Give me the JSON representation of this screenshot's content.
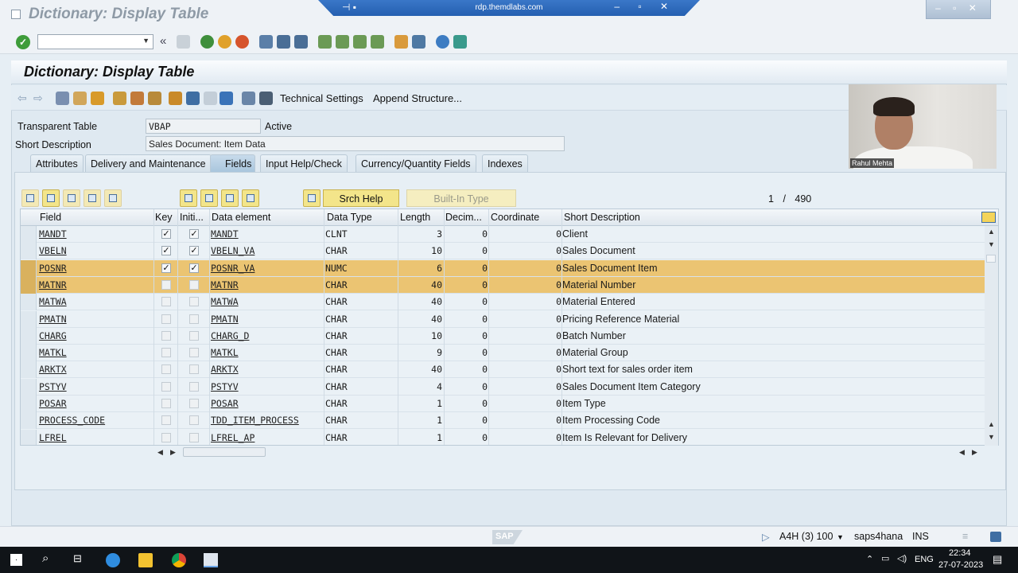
{
  "window": {
    "title": "Dictionary: Display Table",
    "rdp_host": "rdp.themdlabs.com"
  },
  "screen": {
    "title": "Dictionary: Display Table",
    "toolbar_links": [
      "Technical Settings",
      "Append Structure..."
    ]
  },
  "form": {
    "transparent_table_label": "Transparent Table",
    "transparent_table_value": "VBAP",
    "status": "Active",
    "short_description_label": "Short Description",
    "short_description_value": "Sales Document: Item Data"
  },
  "tabs": [
    {
      "label": "Attributes",
      "active": false
    },
    {
      "label": "Delivery and Maintenance",
      "active": false
    },
    {
      "label": "Fields",
      "active": true
    },
    {
      "label": "Input Help/Check",
      "active": false
    },
    {
      "label": "Currency/Quantity Fields",
      "active": false
    },
    {
      "label": "Indexes",
      "active": false
    }
  ],
  "table_toolbar": {
    "srch_help": "Srch Help",
    "built_in_type": "Built-In Type",
    "pager_current": "1",
    "pager_sep": "/",
    "pager_total": "490"
  },
  "columns": [
    "Field",
    "Key",
    "Initi...",
    "Data element",
    "Data Type",
    "Length",
    "Decim...",
    "Coordinate",
    "Short Description"
  ],
  "rows": [
    {
      "field": "MANDT",
      "key": true,
      "init": true,
      "element": "MANDT",
      "type": "CLNT",
      "length": "3",
      "dec": "0",
      "coord": "0",
      "desc": "Client",
      "selected": false
    },
    {
      "field": "VBELN",
      "key": true,
      "init": true,
      "element": "VBELN_VA",
      "type": "CHAR",
      "length": "10",
      "dec": "0",
      "coord": "0",
      "desc": "Sales Document",
      "selected": false
    },
    {
      "field": "POSNR",
      "key": true,
      "init": true,
      "element": "POSNR_VA",
      "type": "NUMC",
      "length": "6",
      "dec": "0",
      "coord": "0",
      "desc": "Sales Document Item",
      "selected": true
    },
    {
      "field": "MATNR",
      "key": false,
      "init": false,
      "element": "MATNR",
      "type": "CHAR",
      "length": "40",
      "dec": "0",
      "coord": "0",
      "desc": "Material Number",
      "selected": true
    },
    {
      "field": "MATWA",
      "key": false,
      "init": false,
      "element": "MATWA",
      "type": "CHAR",
      "length": "40",
      "dec": "0",
      "coord": "0",
      "desc": "Material Entered",
      "selected": false
    },
    {
      "field": "PMATN",
      "key": false,
      "init": false,
      "element": "PMATN",
      "type": "CHAR",
      "length": "40",
      "dec": "0",
      "coord": "0",
      "desc": "Pricing Reference Material",
      "selected": false
    },
    {
      "field": "CHARG",
      "key": false,
      "init": false,
      "element": "CHARG_D",
      "type": "CHAR",
      "length": "10",
      "dec": "0",
      "coord": "0",
      "desc": "Batch Number",
      "selected": false
    },
    {
      "field": "MATKL",
      "key": false,
      "init": false,
      "element": "MATKL",
      "type": "CHAR",
      "length": "9",
      "dec": "0",
      "coord": "0",
      "desc": "Material Group",
      "selected": false
    },
    {
      "field": "ARKTX",
      "key": false,
      "init": false,
      "element": "ARKTX",
      "type": "CHAR",
      "length": "40",
      "dec": "0",
      "coord": "0",
      "desc": "Short text for sales order item",
      "selected": false
    },
    {
      "field": "PSTYV",
      "key": false,
      "init": false,
      "element": "PSTYV",
      "type": "CHAR",
      "length": "4",
      "dec": "0",
      "coord": "0",
      "desc": "Sales Document Item Category",
      "selected": false
    },
    {
      "field": "POSAR",
      "key": false,
      "init": false,
      "element": "POSAR",
      "type": "CHAR",
      "length": "1",
      "dec": "0",
      "coord": "0",
      "desc": "Item Type",
      "selected": false
    },
    {
      "field": "PROCESS_CODE",
      "key": false,
      "init": false,
      "element": "TDD_ITEM_PROCESS",
      "type": "CHAR",
      "length": "1",
      "dec": "0",
      "coord": "0",
      "desc": "Item Processing Code",
      "selected": false
    },
    {
      "field": "LFREL",
      "key": false,
      "init": false,
      "element": "LFREL_AP",
      "type": "CHAR",
      "length": "1",
      "dec": "0",
      "coord": "0",
      "desc": "Item Is Relevant for Delivery",
      "selected": false
    }
  ],
  "webcam": {
    "name": "Rahul Mehta"
  },
  "statusbar": {
    "system": "A4H (3) 100",
    "server": "saps4hana",
    "mode": "INS",
    "logo": "SAP"
  },
  "taskbar": {
    "lang": "ENG",
    "time": "22:34",
    "date": "27-07-2023"
  },
  "colors": {
    "selected_row": "#ebc472",
    "active_tab": "#a9c6dd",
    "button_yellow": "#f3e58a"
  }
}
